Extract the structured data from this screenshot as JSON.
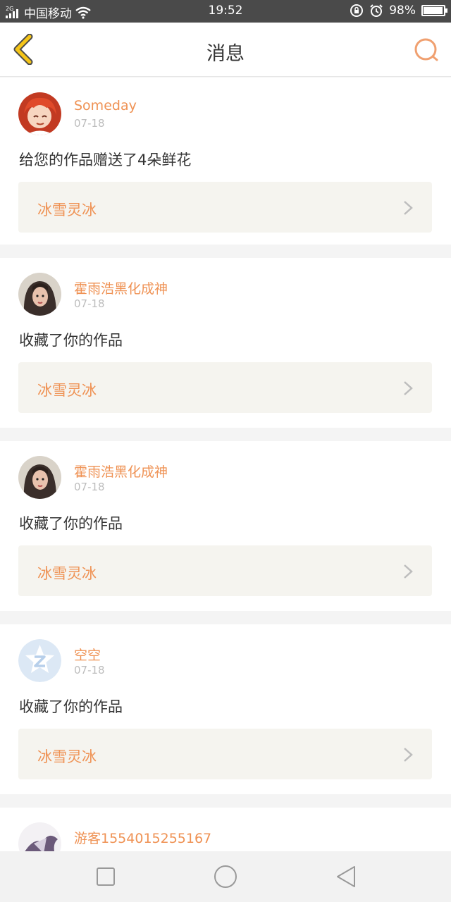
{
  "status": {
    "signal_type": "2G",
    "carrier": "中国移动",
    "time": "19:52",
    "battery": "98%",
    "battery_fraction": 0.98
  },
  "header": {
    "title": "消息"
  },
  "colors": {
    "accent": "#ef9254",
    "back_arrow": "#f5c518",
    "work_bg": "#f5f4ef"
  },
  "messages": [
    {
      "user": "Someday",
      "date": "07-18",
      "action": "给您的作品赠送了4朵鲜花",
      "work": "冰雪灵冰",
      "avatar": "anime-avatar"
    },
    {
      "user": "霍雨浩黑化成神",
      "date": "07-18",
      "action": "收藏了你的作品",
      "work": "冰雪灵冰",
      "avatar": "photo-avatar"
    },
    {
      "user": "霍雨浩黑化成神",
      "date": "07-18",
      "action": "收藏了你的作品",
      "work": "冰雪灵冰",
      "avatar": "photo-avatar"
    },
    {
      "user": "空空",
      "date": "07-18",
      "action": "收藏了你的作品",
      "work": "冰雪灵冰",
      "avatar": "default-avatar"
    },
    {
      "user": "游客1554015255167",
      "avatar": "anime-avatar"
    }
  ],
  "nav": {
    "icons": [
      "recent-apps-icon",
      "home-icon",
      "back-triangle-icon"
    ]
  }
}
